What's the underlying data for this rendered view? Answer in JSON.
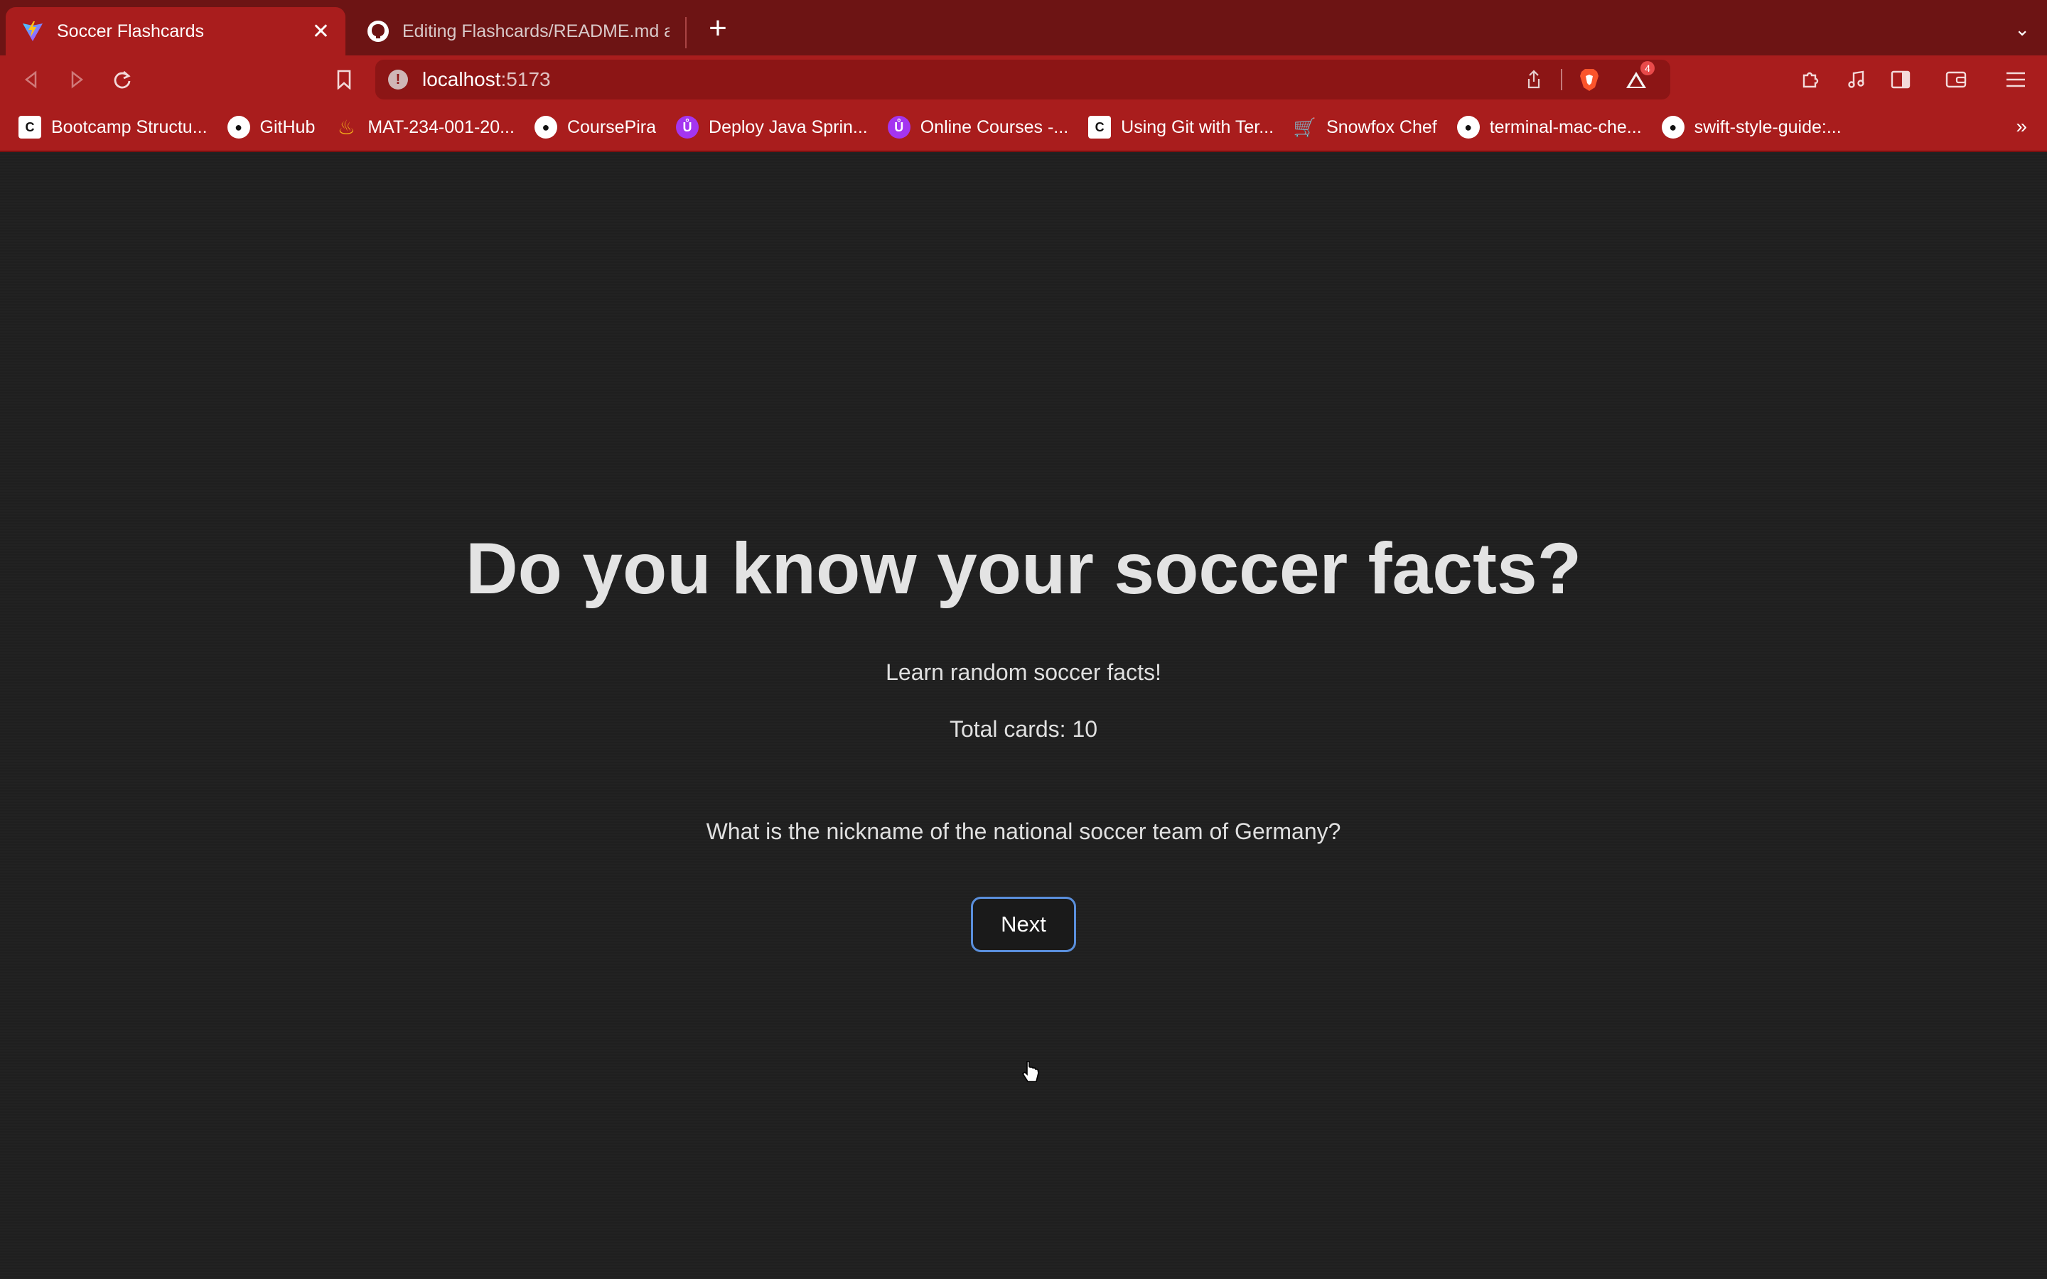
{
  "browser": {
    "tabs": [
      {
        "title": "Soccer Flashcards",
        "icon": "vite-logo-icon",
        "active": true
      },
      {
        "title": "Editing Flashcards/README.md at n",
        "icon": "github-icon",
        "active": false
      }
    ],
    "new_tab_label": "+",
    "url": {
      "host": "localhost",
      "port": ":5173"
    },
    "shields_badge": "4",
    "bookmarks": [
      {
        "label": "Bootcamp Structu...",
        "icon": "codepath-icon"
      },
      {
        "label": "GitHub",
        "icon": "github-icon"
      },
      {
        "label": "MAT-234-001-20...",
        "icon": "flame-icon"
      },
      {
        "label": "CoursePira",
        "icon": "github-icon"
      },
      {
        "label": "Deploy Java Sprin...",
        "icon": "udemy-icon"
      },
      {
        "label": "Online Courses -...",
        "icon": "udemy-icon"
      },
      {
        "label": "Using Git with Ter...",
        "icon": "codepath-icon"
      },
      {
        "label": "Snowfox Chef",
        "icon": "cart-icon"
      },
      {
        "label": "terminal-mac-che...",
        "icon": "github-icon"
      },
      {
        "label": "swift-style-guide:...",
        "icon": "github-icon"
      }
    ],
    "colors": {
      "tab_strip": "#6d1414",
      "toolbar": "#a91d1d",
      "accent_border": "#5a8fdc"
    }
  },
  "page": {
    "title": "Do you know your soccer facts?",
    "subtitle": "Learn random soccer facts!",
    "total_cards": "Total cards: 10",
    "question": "What is the nickname of the national soccer team of Germany?",
    "next_button": "Next"
  }
}
